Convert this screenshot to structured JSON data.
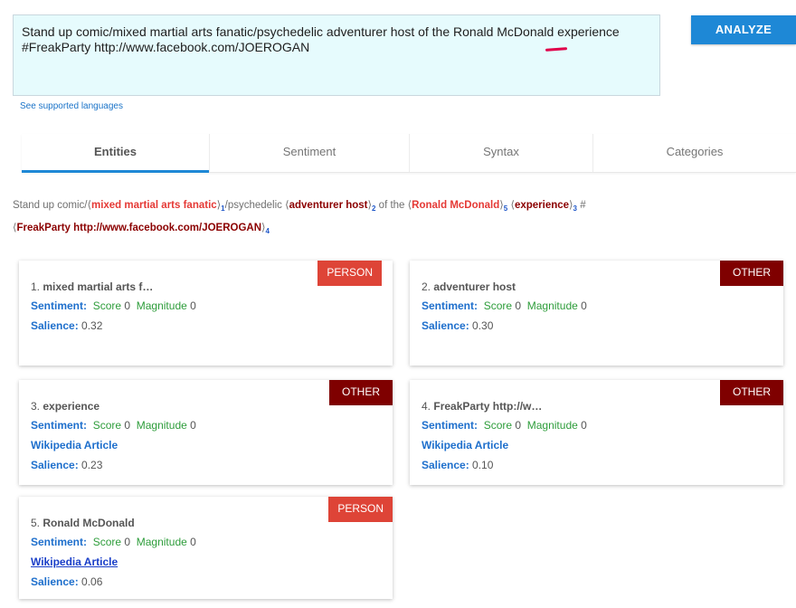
{
  "input": {
    "text": "Stand up comic/mixed martial arts fanatic/psychedelic adventurer host of the Ronald McDonald experience\n#FreakParty http://www.facebook.com/JOEROGAN"
  },
  "analyze_label": "ANALYZE",
  "supported_languages_label": "See supported languages",
  "tabs": [
    {
      "label": "Entities",
      "active": true
    },
    {
      "label": "Sentiment",
      "active": false
    },
    {
      "label": "Syntax",
      "active": false
    },
    {
      "label": "Categories",
      "active": false
    }
  ],
  "annotated": {
    "p1": "Stand up comic/",
    "e1": "mixed martial arts fanatic",
    "s1": "1",
    "p2": "/psychedelic ",
    "e2": "adventurer host",
    "s2": "2",
    "p3": " of the ",
    "e5": "Ronald McDonald",
    "s5": "5",
    "p4": " ",
    "e3": "experience",
    "s3": "3",
    "p5": " #",
    "e4": "FreakParty http://www.facebook.com/JOEROGAN",
    "s4": "4",
    "open": "⟨",
    "close": "⟩"
  },
  "labels": {
    "sentiment": "Sentiment:",
    "score": "Score",
    "magnitude": "Magnitude",
    "salience": "Salience:",
    "wikipedia": "Wikipedia Article"
  },
  "entities": [
    {
      "num": "1.",
      "name": "mixed martial arts f…",
      "type": "PERSON",
      "score": "0",
      "magnitude": "0",
      "salience": "0.32",
      "wiki": false
    },
    {
      "num": "2.",
      "name": "adventurer host",
      "type": "OTHER",
      "score": "0",
      "magnitude": "0",
      "salience": "0.30",
      "wiki": false
    },
    {
      "num": "3.",
      "name": "experience",
      "type": "OTHER",
      "score": "0",
      "magnitude": "0",
      "salience": "0.23",
      "wiki": true
    },
    {
      "num": "4.",
      "name": "FreakParty http://w…",
      "type": "OTHER",
      "score": "0",
      "magnitude": "0",
      "salience": "0.10",
      "wiki": true
    },
    {
      "num": "5.",
      "name": "Ronald McDonald",
      "type": "PERSON",
      "score": "0",
      "magnitude": "0",
      "salience": "0.06",
      "wiki": true
    }
  ],
  "colors": {
    "accent": "#1e88d6",
    "person_badge": "#de4437",
    "other_badge": "#7f0000",
    "entity_red": "#e53935",
    "entity_dark": "#8b0000",
    "green": "#2e9d3b"
  }
}
